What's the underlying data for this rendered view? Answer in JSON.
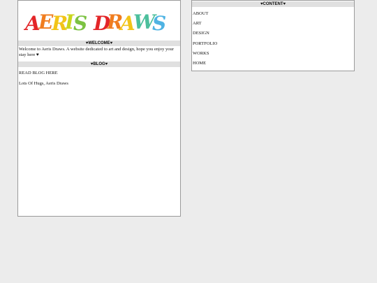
{
  "logo": {
    "text": "AERIS DRAWS",
    "letters": [
      {
        "char": "A",
        "color": "#e32528"
      },
      {
        "char": "E",
        "color": "#f07d1f"
      },
      {
        "char": "R",
        "color": "#f2c418"
      },
      {
        "char": "I",
        "color": "#c9d61c"
      },
      {
        "char": "S",
        "color": "#7cc242"
      },
      {
        "char": " ",
        "color": "#ffffff"
      },
      {
        "char": "D",
        "color": "#e32528"
      },
      {
        "char": "R",
        "color": "#f07d1f"
      },
      {
        "char": "A",
        "color": "#f2c418"
      },
      {
        "char": "W",
        "color": "#4cbf9c"
      },
      {
        "char": "S",
        "color": "#4fb3e3"
      }
    ]
  },
  "welcome": {
    "header": "♥WELCOME♥",
    "text": "Welcome to Aeris Draws. A website dedicated to art and design, hope you enjoy your stay here ♥"
  },
  "blog": {
    "header": "♥BLOG♥",
    "link": "READ BLOG HERE",
    "signoff": "Lots Of Hugs, Aeris Draws"
  },
  "content": {
    "header": "♥CONTENT♥",
    "items": [
      "ABOUT",
      "ART",
      "DESIGN",
      "PORTFOLIO",
      "WORKS",
      "HOME"
    ]
  }
}
